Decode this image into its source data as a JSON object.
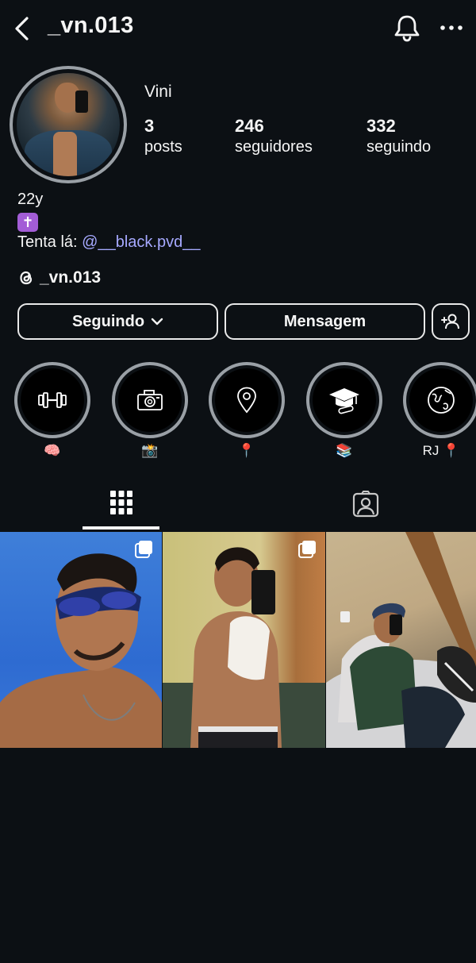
{
  "header": {
    "username": "_vn.013",
    "back_icon": "chevron-left-icon",
    "notification_icon": "bell-icon",
    "more_icon": "more-horizontal-icon"
  },
  "profile": {
    "display_name": "Vini",
    "stats": [
      {
        "value": "3",
        "label": "posts"
      },
      {
        "value": "246",
        "label": "seguidores"
      },
      {
        "value": "332",
        "label": "seguindo"
      }
    ],
    "bio": {
      "age": "22y",
      "emoji": "✝️",
      "line_prefix": "Tenta lá: ",
      "mention": "@__black.pvd__"
    },
    "threads_handle": "_vn.013"
  },
  "actions": {
    "following_label": "Seguindo",
    "message_label": "Mensagem",
    "add_friend_icon": "person-add-icon"
  },
  "highlights": [
    {
      "icon": "dumbbell-icon",
      "label": "🧠"
    },
    {
      "icon": "camera-icon",
      "label": "📸"
    },
    {
      "icon": "location-pin-icon",
      "label": "📍"
    },
    {
      "icon": "graduation-cap-icon",
      "label": "📚"
    },
    {
      "icon": "globe-icon",
      "label": "RJ 📍"
    }
  ],
  "tabs": [
    {
      "icon": "grid-icon",
      "active": true
    },
    {
      "icon": "tagged-person-icon",
      "active": false
    }
  ],
  "colors": {
    "background": "#0c1014",
    "mention": "#a6a9ff",
    "ring": "#9aa0a6"
  }
}
